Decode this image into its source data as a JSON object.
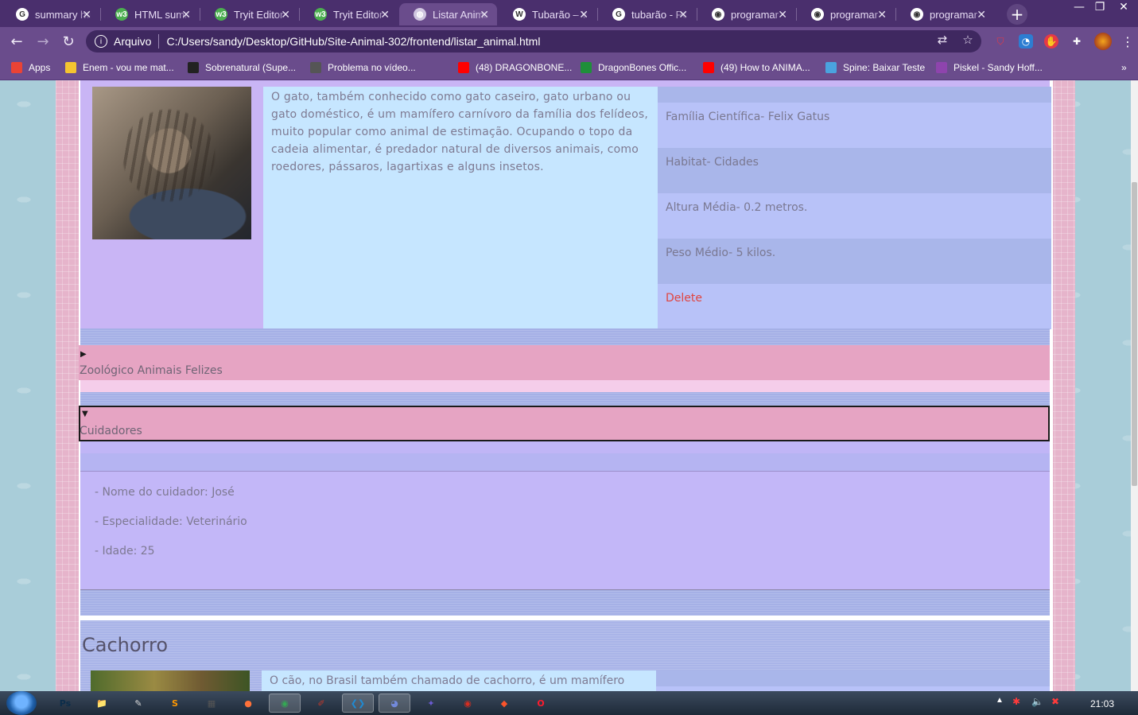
{
  "browser": {
    "tabs": [
      {
        "title": "summary html",
        "icon": "google-icon",
        "color": "#ffffff",
        "letter": "G"
      },
      {
        "title": "HTML summary",
        "icon": "w3schools-icon",
        "color": "#4CAF50",
        "letter": "w3"
      },
      {
        "title": "Tryit Editor",
        "icon": "w3schools-icon",
        "color": "#4CAF50",
        "letter": "w3"
      },
      {
        "title": "Tryit Editor",
        "icon": "w3schools-icon",
        "color": "#4CAF50",
        "letter": "w3"
      },
      {
        "title": "Listar Animal",
        "icon": "globe-icon",
        "color": "#d0c6e0",
        "letter": "◍",
        "active": true
      },
      {
        "title": "Tubarão – Wikipédia",
        "icon": "wikipedia-icon",
        "color": "#ffffff",
        "letter": "W"
      },
      {
        "title": "tubarão - Pesquisa",
        "icon": "google-icon",
        "color": "#ffffff",
        "letter": "G"
      },
      {
        "title": "programar",
        "icon": "github-icon",
        "color": "#ffffff",
        "letter": "◉"
      },
      {
        "title": "programar",
        "icon": "github-icon",
        "color": "#ffffff",
        "letter": "◉"
      },
      {
        "title": "programar",
        "icon": "github-icon",
        "color": "#ffffff",
        "letter": "◉"
      }
    ],
    "address": {
      "scheme": "Arquivo",
      "url": "C:/Users/sandy/Desktop/GitHub/Site-Animal-302/frontend/listar_animal.html"
    },
    "bookmarks": [
      {
        "label": "Apps",
        "icon": "apps-grid-icon",
        "color": "#ea4335"
      },
      {
        "label": "Enem - vou me mat...",
        "icon": "folder-icon",
        "color": "#f4c430"
      },
      {
        "label": "Sobrenatural (Supe...",
        "icon": "sf-icon",
        "color": "#222222"
      },
      {
        "label": "Problema no vídeo...",
        "icon": "site-icon",
        "color": "#555555"
      },
      {
        "label": "(48) DRAGONBONE...",
        "icon": "youtube-icon",
        "color": "#ff0000"
      },
      {
        "label": "DragonBones Offic...",
        "icon": "dragonbones-icon",
        "color": "#1f8f3a"
      },
      {
        "label": "(49) How to ANIMA...",
        "icon": "youtube-icon",
        "color": "#ff0000"
      },
      {
        "label": "Spine: Baixar Teste",
        "icon": "spine-icon",
        "color": "#4aa3df"
      },
      {
        "label": "Piskel - Sandy Hoff...",
        "icon": "piskel-icon",
        "color": "#8e44ad"
      }
    ]
  },
  "animal_gato": {
    "description": "O gato, também conhecido como gato caseiro, gato urbano ou gato doméstico, é um mamífero carnívoro da família dos felídeos, muito popular como animal de estimação. Ocupando o topo da cadeia alimentar, é predador natural de diversos animais, como roedores, pássaros, lagartixas e alguns insetos.",
    "facts": {
      "familia": "Família Científica- Felix Gatus",
      "habitat": "Habitat- Cidades",
      "altura": "Altura Média- 0.2 metros.",
      "peso": "Peso Médio- 5 kilos."
    },
    "delete_label": "Delete"
  },
  "zoologico": {
    "summary": "Zoológico Animais Felizes",
    "arrow": "▶"
  },
  "cuidadores": {
    "summary": "Cuidadores",
    "arrow": "▼",
    "lines": [
      "- Nome do cuidador: José",
      "- Especialidade: Veterinário",
      "- Idade: 25"
    ]
  },
  "animal_cachorro": {
    "name": "Cachorro",
    "description": "O cão, no Brasil também chamado de cachorro, é um mamífero"
  },
  "taskbar": {
    "apps": [
      {
        "name": "photoshop-icon",
        "label": "Ps",
        "color": "#0b2d4a"
      },
      {
        "name": "explorer-icon",
        "label": "📁",
        "color": "#e8c25a"
      },
      {
        "name": "note-icon",
        "label": "✎",
        "color": "#d9d9d9"
      },
      {
        "name": "sublime-icon",
        "label": "S",
        "color": "#ff9800"
      },
      {
        "name": "calculator-icon",
        "label": "▦",
        "color": "#555555"
      },
      {
        "name": "firefox-icon",
        "label": "●",
        "color": "#ff7139"
      },
      {
        "name": "chrome-icon",
        "label": "◉",
        "color": "#34a853"
      },
      {
        "name": "paint-icon",
        "label": "✐",
        "color": "#c0392b"
      },
      {
        "name": "vscode-icon",
        "label": "❮❯",
        "color": "#1f8ad2"
      },
      {
        "name": "discord-icon",
        "label": "◕",
        "color": "#7289da"
      },
      {
        "name": "tool-icon",
        "label": "✦",
        "color": "#6b5bd2"
      },
      {
        "name": "record-icon",
        "label": "◉",
        "color": "#d62d20"
      },
      {
        "name": "brave-icon",
        "label": "◆",
        "color": "#fb542b"
      },
      {
        "name": "opera-icon",
        "label": "O",
        "color": "#ff1b2d"
      }
    ],
    "clock": "21:03"
  }
}
